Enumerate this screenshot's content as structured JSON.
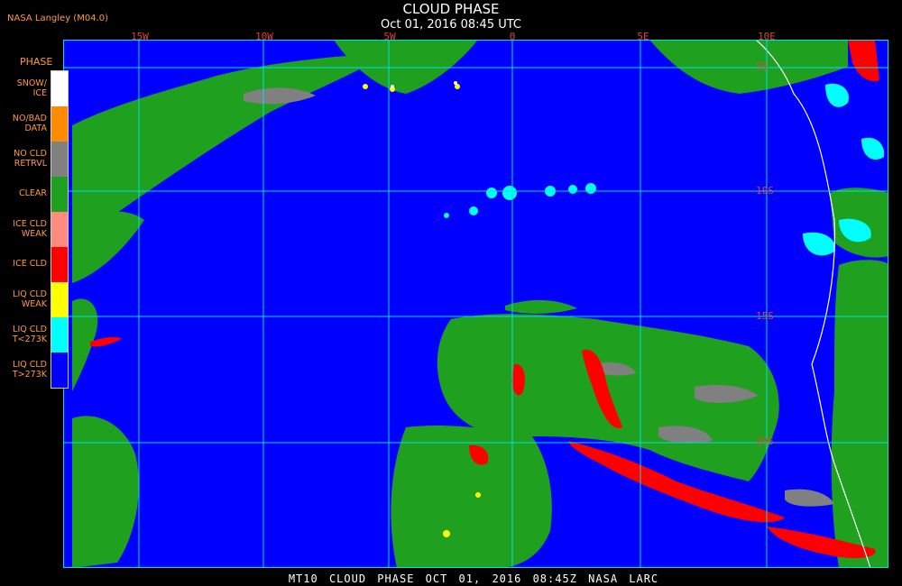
{
  "header": {
    "title": "CLOUD PHASE",
    "subtitle": "Oct 01, 2016 08:45 UTC",
    "source": "NASA Langley (M04.0)"
  },
  "grid": {
    "lon_labels": [
      "15W",
      "10W",
      "5W",
      "0",
      "5E",
      "10E"
    ],
    "lat_labels": [
      "5S",
      "10S",
      "15S",
      "20S"
    ]
  },
  "legend": {
    "title": "PHASE",
    "items": [
      {
        "label": "SNOW/\nICE",
        "color": "#ffffff"
      },
      {
        "label": "NO/BAD\nDATA",
        "color": "#ff8c00"
      },
      {
        "label": "NO CLD\nRETRVL",
        "color": "#808080"
      },
      {
        "label": "CLEAR",
        "color": "#1fa01f"
      },
      {
        "label": "ICE CLD\nWEAK",
        "color": "#ff8a80"
      },
      {
        "label": "ICE CLD",
        "color": "#ff0000"
      },
      {
        "label": "LIQ CLD\nWEAK",
        "color": "#ffff00"
      },
      {
        "label": "LIQ CLD\nT<273K",
        "color": "#00ffff"
      },
      {
        "label": "LIQ CLD\nT>273K",
        "color": "#0000ff"
      }
    ]
  },
  "footer": "MT10 CLOUD PHASE OCT 01, 2016 08:45Z NASA LARC"
}
